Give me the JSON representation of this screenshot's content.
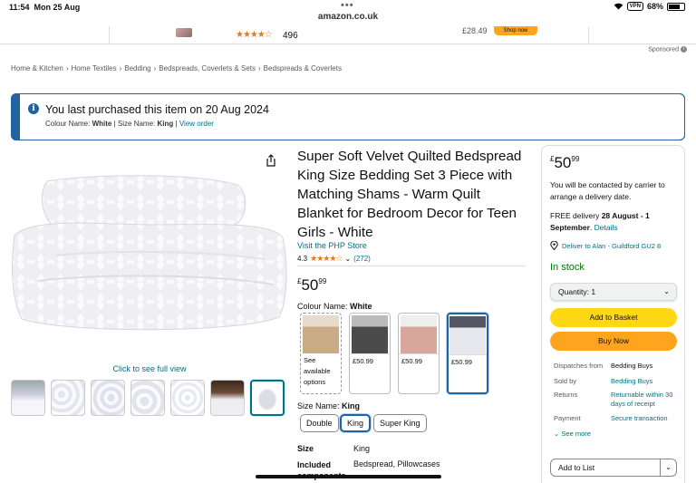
{
  "statusbar": {
    "time": "11:54",
    "date": "Mon 25 Aug",
    "dots": "•••",
    "vpn": "VPN",
    "battery": "68%"
  },
  "browser": {
    "url": "amazon.co.uk"
  },
  "ad_strip": {
    "review_stars": "★★★★☆",
    "review_count": "496",
    "price": "£28.49",
    "shop_now": "Shop now"
  },
  "sponsored": {
    "label": "Sponsored",
    "info": "i"
  },
  "breadcrumb": [
    "Home & Kitchen",
    "Home Textiles",
    "Bedding",
    "Bedspreads, Coverlets & Sets",
    "Bedspreads & Coverlets"
  ],
  "breadcrumb_sep": "›",
  "purchase_banner": {
    "icon": "i",
    "title": "You last purchased this item on 20 Aug 2024",
    "colour_label": "Colour Name:",
    "colour_value": "White",
    "separator": "|",
    "size_label": "Size Name:",
    "size_value": "King",
    "view_order": "View order"
  },
  "gallery": {
    "see_full_view": "Click to see full view",
    "thumbnail_count": 7,
    "selected_thumbnail": 7
  },
  "product": {
    "title": "Super Soft Velvet Quilted Bedspread King Size Bedding Set 3 Piece with Matching Shams - Warm Quilt Blanket for Bedroom Decor for Teen Girls - White",
    "store": "Visit the PHP Store",
    "rating_value": "4.3",
    "rating_stars": "★★★★☆",
    "rating_dropdown": "⌄",
    "rating_count": "(272)",
    "price_symbol": "£",
    "price_whole": "50",
    "price_fraction": "99",
    "colour_label": "Colour Name: ",
    "colour_selected": "White",
    "colours": [
      {
        "name": "beige",
        "price": "",
        "note": "See available options",
        "color": "#c9ab85"
      },
      {
        "name": "grey",
        "price": "£50.99",
        "note": "",
        "color": "#4b4b4b"
      },
      {
        "name": "pink",
        "price": "£50.99",
        "note": "",
        "color": "#d8a79b"
      },
      {
        "name": "white",
        "price": "£50.99",
        "note": "",
        "color": "#e7e7ee"
      }
    ],
    "size_label": "Size Name: ",
    "size_selected": "King",
    "sizes": [
      "Double",
      "King",
      "Super King"
    ],
    "specs": [
      {
        "key": "Size",
        "value": "King"
      },
      {
        "key": "Included components",
        "value": "Bedspread, Pillowcases"
      }
    ]
  },
  "buybox": {
    "price_symbol": "£",
    "price_whole": "50",
    "price_fraction": "99",
    "contact_note": "You will be contacted by carrier to arrange a delivery date.",
    "delivery_prefix": "FREE delivery ",
    "delivery_date": "28 August - 1 September",
    "delivery_suffix": ". ",
    "details": "Details",
    "deliver_to": "Deliver to Alan - Guildford GU2 8",
    "stock": "In stock",
    "quantity": "Quantity:  1",
    "add_to_basket": "Add to Basket",
    "buy_now": "Buy Now",
    "info_rows": [
      {
        "label": "Dispatches from",
        "value": "Bedding Buys"
      },
      {
        "label": "Sold by",
        "value": "Bedding Buys"
      },
      {
        "label": "Returns",
        "value": "Returnable within 30 days of receipt"
      },
      {
        "label": "Payment",
        "value": "Secure transaction"
      }
    ],
    "see_more": "See more",
    "add_to_list": "Add to List"
  },
  "colors": {
    "link": "#007185",
    "banner_border": "#2162a1",
    "cart_button": "#ffd814",
    "buy_button": "#ffa41c",
    "stars": "#de7921",
    "in_stock": "#007600"
  }
}
